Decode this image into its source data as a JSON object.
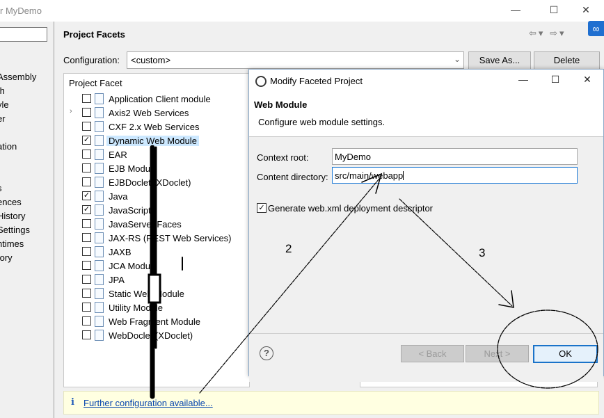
{
  "window": {
    "title_fragment": "r MyDemo"
  },
  "left_nav": {
    "items": [
      "Assembly",
      "th",
      "yle",
      "er",
      "ation",
      "s",
      "ences",
      "History",
      "Settings",
      "ntimes",
      "tory"
    ]
  },
  "page": {
    "title": "Project Facets"
  },
  "configuration": {
    "label": "Configuration:",
    "value": "<custom>",
    "save_as_label": "Save As...",
    "delete_label": "Delete"
  },
  "facets": {
    "header": "Project Facet",
    "items": [
      {
        "label": "Application Client module",
        "checked": false,
        "expandable": false
      },
      {
        "label": "Axis2 Web Services",
        "checked": false,
        "expandable": true
      },
      {
        "label": "CXF 2.x Web Services",
        "checked": false,
        "expandable": false
      },
      {
        "label": "Dynamic Web Module",
        "checked": true,
        "expandable": false,
        "selected": true
      },
      {
        "label": "EAR",
        "checked": false,
        "expandable": false
      },
      {
        "label": "EJB Module",
        "checked": false,
        "expandable": false
      },
      {
        "label": "EJBDoclet (XDoclet)",
        "checked": false,
        "expandable": false
      },
      {
        "label": "Java",
        "checked": true,
        "expandable": false
      },
      {
        "label": "JavaScript",
        "checked": true,
        "expandable": false
      },
      {
        "label": "JavaServer Faces",
        "checked": false,
        "expandable": false
      },
      {
        "label": "JAX-RS (REST Web Services)",
        "checked": false,
        "expandable": false
      },
      {
        "label": "JAXB",
        "checked": false,
        "expandable": false
      },
      {
        "label": "JCA Module",
        "checked": false,
        "expandable": false
      },
      {
        "label": "JPA",
        "checked": false,
        "expandable": false
      },
      {
        "label": "Static Web Module",
        "checked": false,
        "expandable": false
      },
      {
        "label": "Utility Module",
        "checked": false,
        "expandable": false
      },
      {
        "label": "Web Fragment Module",
        "checked": false,
        "expandable": false
      },
      {
        "label": "WebDoclet (XDoclet)",
        "checked": false,
        "expandable": false
      }
    ]
  },
  "info_bar": {
    "link_text": "Further configuration available..."
  },
  "dialog": {
    "title": "Modify Faceted Project",
    "heading": "Web Module",
    "subtitle": "Configure web module settings.",
    "context_root_label": "Context root:",
    "context_root_value": "MyDemo",
    "content_dir_label": "Content directory:",
    "content_dir_value": "src/main/webapp",
    "generate_label": "Generate web.xml deployment descriptor",
    "generate_checked": true,
    "back_label": "< Back",
    "next_label": "Next >",
    "ok_label": "OK"
  },
  "annotations": {
    "step2": "2",
    "step3": "3"
  },
  "colors": {
    "accent": "#1a73c9",
    "selection": "#cce8ff",
    "info_bg": "#ffffe1",
    "link": "#0645ad"
  }
}
